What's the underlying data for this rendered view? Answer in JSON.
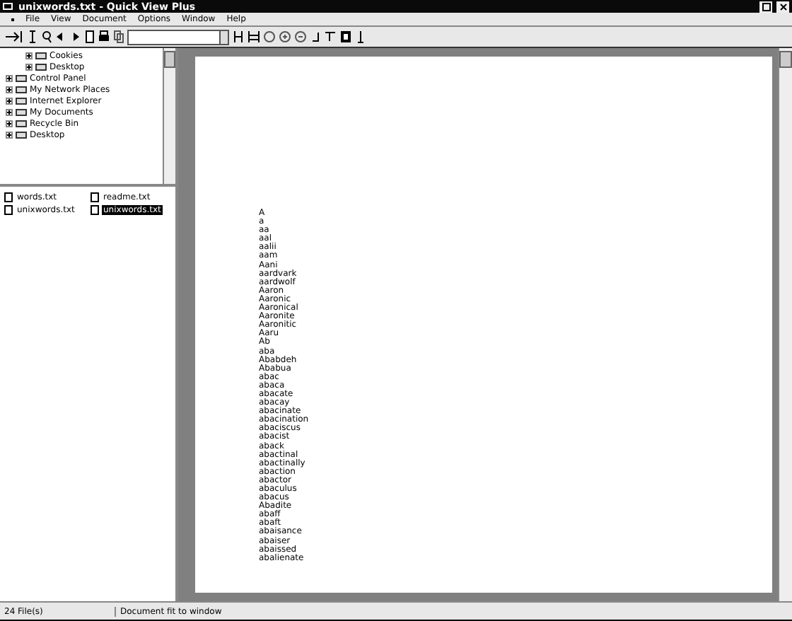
{
  "window": {
    "title": "unixwords.txt - Quick View Plus"
  },
  "menu": [
    "File",
    "View",
    "Document",
    "Options",
    "Window",
    "Help"
  ],
  "tree": {
    "partial_branch": [
      {
        "label": "Cookies",
        "expanded": false
      },
      {
        "label": "Desktop",
        "expanded": false
      }
    ],
    "items": [
      {
        "label": "Control Panel",
        "expanded": false
      },
      {
        "label": "My Network Places",
        "expanded": false
      },
      {
        "label": "Internet Explorer",
        "expanded": false
      },
      {
        "label": "My Documents",
        "expanded": false
      },
      {
        "label": "Recycle Bin",
        "expanded": false
      },
      {
        "label": "Desktop",
        "expanded": false
      }
    ]
  },
  "files": [
    {
      "name": "words.txt",
      "selected": false
    },
    {
      "name": "readme.txt",
      "selected": false
    },
    {
      "name": "unixwords.txt",
      "selected": false
    },
    {
      "name": "unixwords.txt",
      "selected": true
    }
  ],
  "document": {
    "lines": [
      "A",
      "a",
      "aa",
      "aal",
      "aalii",
      "aam",
      "Aani",
      "aardvark",
      "aardwolf",
      "Aaron",
      "Aaronic",
      "Aaronical",
      "Aaronite",
      "Aaronitic",
      "Aaru",
      "Ab",
      "aba",
      "Ababdeh",
      "Ababua",
      "abac",
      "abaca",
      "abacate",
      "abacay",
      "abacinate",
      "abacination",
      "abaciscus",
      "abacist",
      "aback",
      "abactinal",
      "abactinally",
      "abaction",
      "abactor",
      "abaculus",
      "abacus",
      "Abadite",
      "abaff",
      "abaft",
      "abaisance",
      "abaiser",
      "abaissed",
      "abalienate"
    ]
  },
  "status_bar": [
    "24 File(s)",
    "Document fit to window"
  ]
}
